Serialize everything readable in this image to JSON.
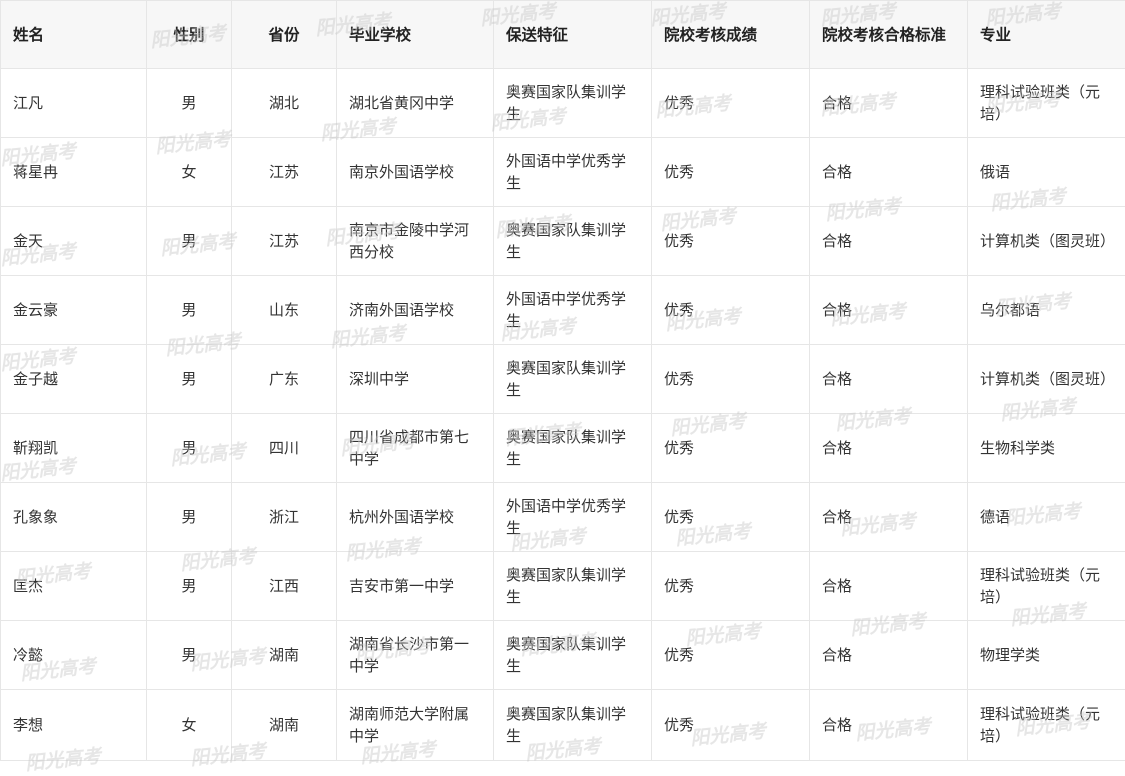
{
  "headers": [
    "姓名",
    "性别",
    "省份",
    "毕业学校",
    "保送特征",
    "院校考核成绩",
    "院校考核合格标准",
    "专业"
  ],
  "rows": [
    [
      "江凡",
      "男",
      "湖北",
      "湖北省黄冈中学",
      "奥赛国家队集训学生",
      "优秀",
      "合格",
      "理科试验班类（元培）"
    ],
    [
      "蒋星冉",
      "女",
      "江苏",
      "南京外国语学校",
      "外国语中学优秀学生",
      "优秀",
      "合格",
      "俄语"
    ],
    [
      "金天",
      "男",
      "江苏",
      "南京市金陵中学河西分校",
      "奥赛国家队集训学生",
      "优秀",
      "合格",
      "计算机类（图灵班）"
    ],
    [
      "金云豪",
      "男",
      "山东",
      "济南外国语学校",
      "外国语中学优秀学生",
      "优秀",
      "合格",
      "乌尔都语"
    ],
    [
      "金子越",
      "男",
      "广东",
      "深圳中学",
      "奥赛国家队集训学生",
      "优秀",
      "合格",
      "计算机类（图灵班）"
    ],
    [
      "靳翔凯",
      "男",
      "四川",
      "四川省成都市第七中学",
      "奥赛国家队集训学生",
      "优秀",
      "合格",
      "生物科学类"
    ],
    [
      "孔象象",
      "男",
      "浙江",
      "杭州外国语学校",
      "外国语中学优秀学生",
      "优秀",
      "合格",
      "德语"
    ],
    [
      "匡杰",
      "男",
      "江西",
      "吉安市第一中学",
      "奥赛国家队集训学生",
      "优秀",
      "合格",
      "理科试验班类（元培）"
    ],
    [
      "冷懿",
      "男",
      "湖南",
      "湖南省长沙市第一中学",
      "奥赛国家队集训学生",
      "优秀",
      "合格",
      "物理学类"
    ],
    [
      "李想",
      "女",
      "湖南",
      "湖南师范大学附属中学",
      "奥赛国家队集训学生",
      "优秀",
      "合格",
      "理科试验班类（元培）"
    ]
  ],
  "watermark": "阳光高考"
}
